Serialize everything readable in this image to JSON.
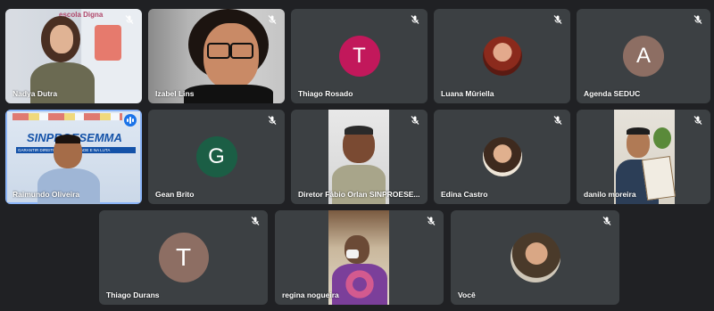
{
  "participants": [
    {
      "name": "Nadya Dutra",
      "type": "video",
      "muted": true,
      "wall_text": "escola Digna"
    },
    {
      "name": "Izabel Lins",
      "type": "video",
      "muted": true
    },
    {
      "name": "Thiago Rosado",
      "type": "avatar",
      "initial": "T",
      "color": "#c2185b",
      "muted": true
    },
    {
      "name": "Luana Mûriella",
      "type": "photo",
      "muted": true
    },
    {
      "name": "Agenda SEDUC",
      "type": "avatar",
      "initial": "A",
      "color": "#8d6e63",
      "muted": true
    },
    {
      "name": "Raimundo Oliveira",
      "type": "video",
      "muted": false,
      "speaking": true,
      "banner_title": "SINPROESEMMA",
      "banner_subtitle": "GARANTIR DIREITOS ... NA UNIDADE E NA LUTA"
    },
    {
      "name": "Gean Brito",
      "type": "avatar",
      "initial": "G",
      "color": "#1b5e45",
      "muted": true
    },
    {
      "name": "Diretor Fábio Orlan SINPROESE...",
      "type": "video",
      "muted": true
    },
    {
      "name": "Edina Castro",
      "type": "photo",
      "muted": true
    },
    {
      "name": "danilo moreira",
      "type": "video",
      "muted": true
    },
    {
      "name": "Thiago Durans",
      "type": "avatar",
      "initial": "T",
      "color": "#8d6e63",
      "muted": true
    },
    {
      "name": "regina nogueira",
      "type": "video",
      "muted": true
    },
    {
      "name": "Você",
      "type": "photo",
      "muted": true
    }
  ],
  "colors": {
    "background": "#202124",
    "tile": "#3c4043",
    "speaking_accent": "#1a73e8"
  }
}
